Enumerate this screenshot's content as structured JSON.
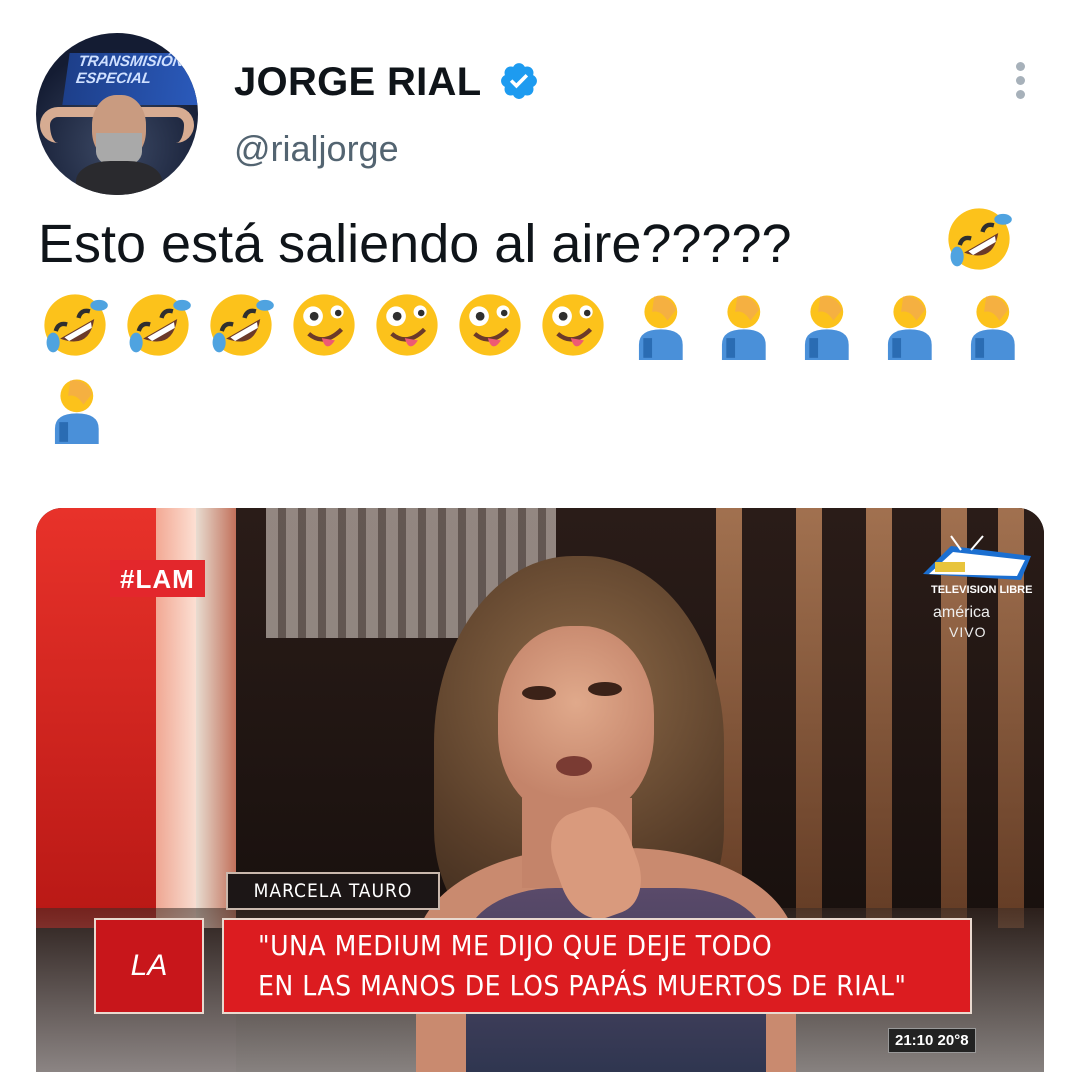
{
  "author": {
    "name": "JORGE RIAL",
    "handle": "@rialjorge",
    "avatar_banner": "TRANSMISIÓN ESPECIAL",
    "verified": true
  },
  "tweet": {
    "text": "Esto está saliendo al aire?????",
    "emoji_sequence": [
      "rofl",
      "rofl",
      "rofl",
      "rofl",
      "zany-face",
      "zany-face",
      "zany-face",
      "zany-face",
      "facepalm",
      "facepalm",
      "facepalm",
      "facepalm",
      "facepalm",
      "facepalm"
    ]
  },
  "media": {
    "hashtag": "#LAM",
    "channel_logo_text": "TELEVISION LIBRE",
    "channel_name": "américa",
    "live_label": "VIVO",
    "guest_name": "MARCELA TAURO",
    "show_logo_text": "LA",
    "quote_line1": "\"UNA MEDIUM ME DIJO QUE DEJE TODO",
    "quote_line2": "EN LAS MANOS DE LOS PAPÁS MUERTOS DE RIAL\"",
    "clock": "21:10 20°8"
  },
  "colors": {
    "verified_blue": "#1d9bf0",
    "handle_gray": "#536471",
    "lam_red": "#e3272c",
    "lower_third_red": "#dc1c20"
  }
}
